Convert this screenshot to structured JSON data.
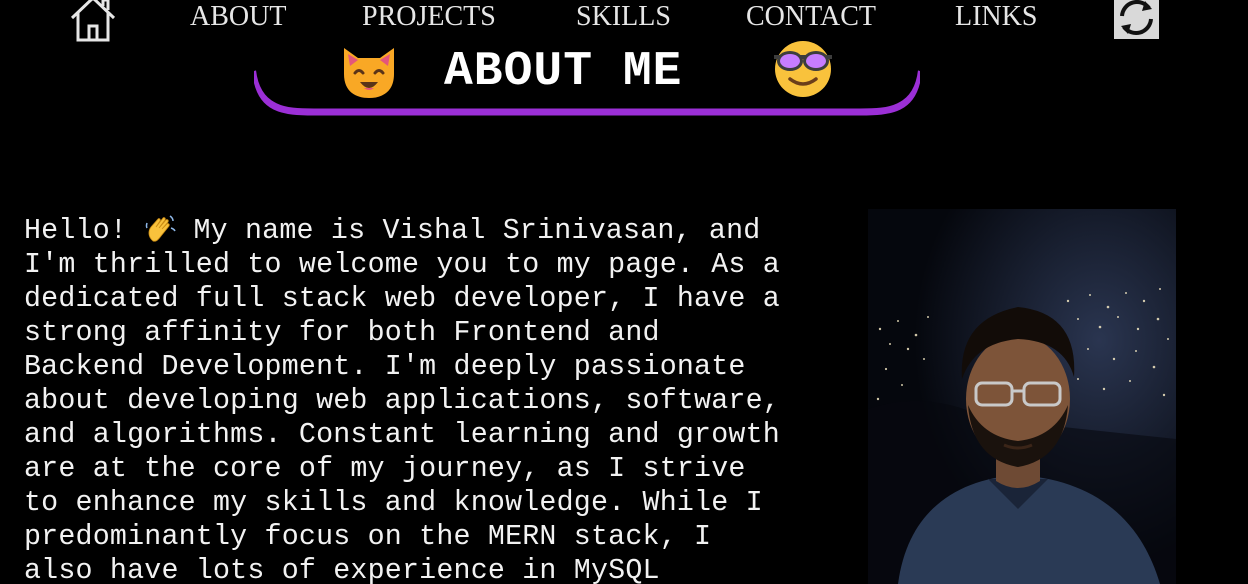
{
  "nav": {
    "home_label": "home-icon",
    "links": [
      {
        "label": "ABOUT"
      },
      {
        "label": "PROJECTS"
      },
      {
        "label": "SKILLS"
      },
      {
        "label": "CONTACT"
      },
      {
        "label": "LINKS"
      }
    ],
    "refresh_icon": "refresh-icon"
  },
  "banner": {
    "title": "ABOUT ME",
    "left_emoji": "cat-face-icon",
    "right_emoji": "smiling-face-with-sunglasses-icon",
    "underline_color": "#9b2fd6"
  },
  "bio": {
    "lines": [
      {
        "before": "Hello! ",
        "after": " My name is Vishal Srinivasan, and"
      },
      {
        "text": "I'm thrilled to welcome you to my page. As a"
      },
      {
        "text": "dedicated full stack web developer, I have a"
      },
      {
        "text": "strong affinity for both Frontend and"
      },
      {
        "text": "Backend Development. I'm deeply passionate"
      },
      {
        "text": "about developing web applications, software,"
      },
      {
        "text": "and algorithms. Constant learning and growth"
      },
      {
        "text": "are at the core of my journey, as I strive"
      },
      {
        "text": "to enhance my skills and knowledge. While I"
      },
      {
        "text": "predominantly focus on the MERN stack, I"
      },
      {
        "text": "also have lots of experience in MySQL"
      }
    ],
    "wave_emoji": "waving-hand-icon"
  },
  "photo": {
    "alt_name": "profile-photo"
  },
  "colors": {
    "background": "#000000",
    "text": "#f2f2f2",
    "accent": "#9b2fd6",
    "emoji_yellow": "#f9c23c"
  }
}
